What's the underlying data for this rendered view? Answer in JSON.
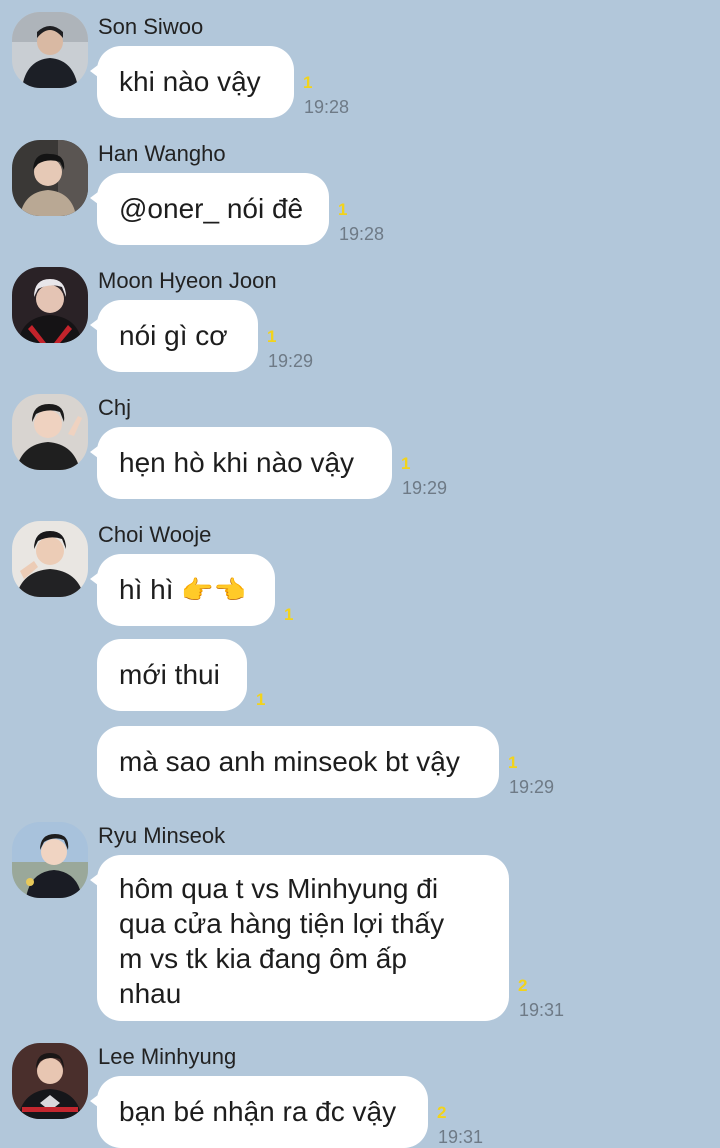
{
  "messages": [
    {
      "sender": "Son Siwoo",
      "text": "khi nào vậy",
      "unread": "1",
      "time": "19:28"
    },
    {
      "sender": "Han Wangho",
      "text": "@oner_ nói đê",
      "unread": "1",
      "time": "19:28"
    },
    {
      "sender": "Moon Hyeon Joon",
      "text": "nói gì cơ",
      "unread": "1",
      "time": "19:29"
    },
    {
      "sender": "Chj",
      "text": "hẹn hò khi nào vậy",
      "unread": "1",
      "time": "19:29"
    },
    {
      "sender": "Choi Wooje",
      "text": "hì hì",
      "emoji": "👉👈",
      "unread": "1"
    },
    {
      "text": "mới thui",
      "unread": "1"
    },
    {
      "text": "mà sao anh minseok bt vậy",
      "unread": "1",
      "time": "19:29"
    },
    {
      "sender": "Ryu Minseok",
      "lines": [
        "hôm qua t vs Minhyung đi",
        "qua cửa hàng tiện lợi thấy",
        "m vs tk kia đang ôm ấp",
        "nhau"
      ],
      "unread": "2",
      "time": "19:31"
    },
    {
      "sender": "Lee Minhyung",
      "text": "bạn bé nhận ra đc vậy",
      "unread": "2",
      "time": "19:31"
    }
  ],
  "colors": {
    "background": "#b2c7da",
    "bubble": "#ffffff",
    "unread": "#f2d31b",
    "time": "#6e7a86"
  },
  "icons": {
    "avatar": "profile-photo",
    "emoji": "pointing-fingers-emoji"
  }
}
